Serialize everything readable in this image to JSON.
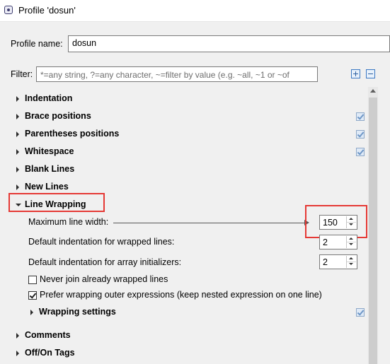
{
  "window": {
    "title": "Profile 'dosun'"
  },
  "profile": {
    "label": "Profile name:",
    "value": "dosun"
  },
  "filter": {
    "label": "Filter:",
    "placeholder": "*=any string, ?=any character, ~=filter by value (e.g. ~all, ~1 or ~of",
    "expand_icon": "expand-all-icon",
    "collapse_icon": "collapse-all-icon"
  },
  "tree": {
    "sections": [
      {
        "label": "Indentation",
        "expanded": false,
        "modified": false
      },
      {
        "label": "Brace positions",
        "expanded": false,
        "modified": true
      },
      {
        "label": "Parentheses positions",
        "expanded": false,
        "modified": true
      },
      {
        "label": "Whitespace",
        "expanded": false,
        "modified": true
      },
      {
        "label": "Blank Lines",
        "expanded": false,
        "modified": false
      },
      {
        "label": "New Lines",
        "expanded": false,
        "modified": false
      },
      {
        "label": "Line Wrapping",
        "expanded": true,
        "modified": false
      },
      {
        "label": "Comments",
        "expanded": false,
        "modified": false
      },
      {
        "label": "Off/On Tags",
        "expanded": false,
        "modified": false
      }
    ],
    "line_wrapping": {
      "max_width_label": "Maximum line width:",
      "max_width_value": "150",
      "default_indent_label": "Default indentation for wrapped lines:",
      "default_indent_value": "2",
      "array_indent_label": "Default indentation for array initializers:",
      "array_indent_value": "2",
      "never_join_label": "Never join already wrapped lines",
      "never_join_checked": false,
      "prefer_outer_label": "Prefer wrapping outer expressions (keep nested expression on one line)",
      "prefer_outer_checked": true,
      "wrapping_settings_label": "Wrapping settings",
      "wrapping_settings_modified": true
    }
  },
  "colors": {
    "highlight": "#e53935",
    "accent": "#3b78c2",
    "modified_check": "#6e96c6"
  }
}
